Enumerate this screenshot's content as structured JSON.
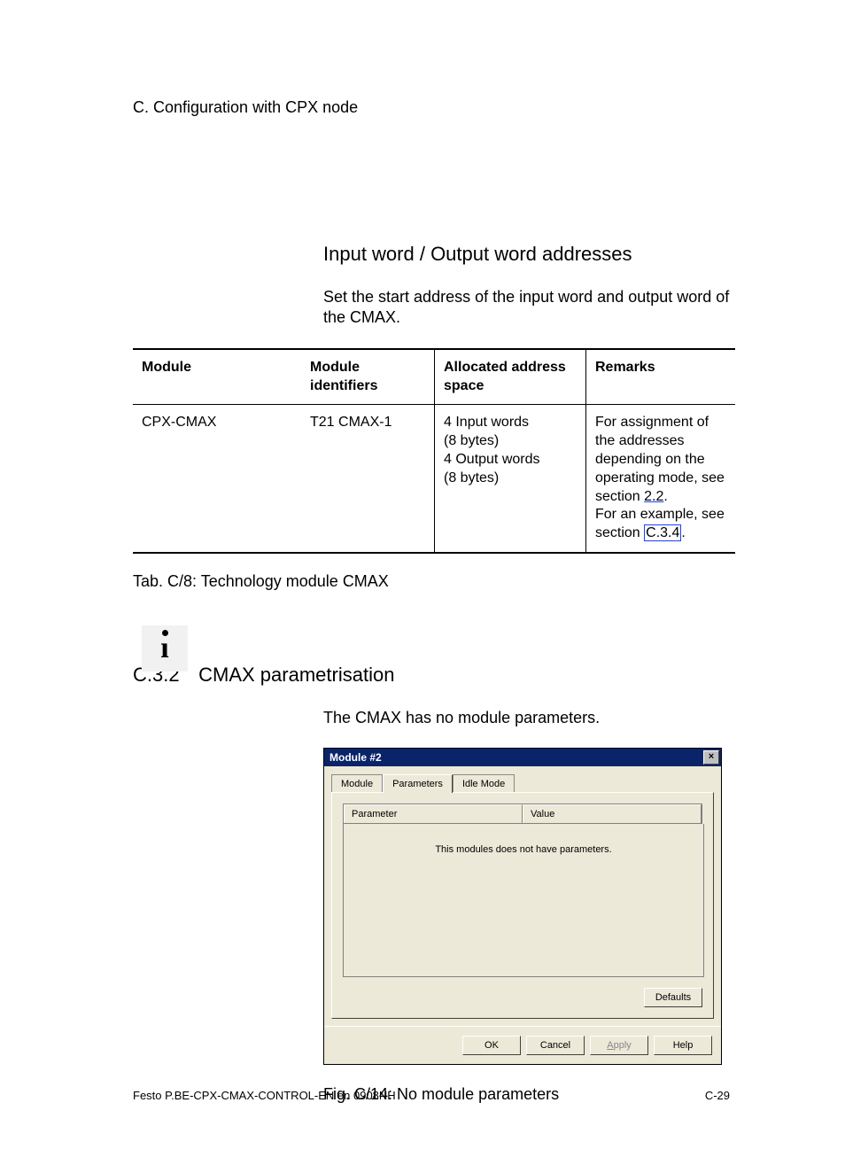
{
  "chapter_label": "C.   Configuration with CPX node",
  "section_io": {
    "title": "Input word / Output word addresses",
    "body": "Set the start address of the input word and output word of the CMAX."
  },
  "table": {
    "headers": {
      "module": "Module",
      "identifiers": "Module identifiers",
      "space": "Allocated address space",
      "remarks": "Remarks"
    },
    "row": {
      "module": "CPX-CMAX",
      "identifiers": "T21 CMAX-1",
      "space": "4 Input words\n(8 bytes)\n4 Output words\n(8 bytes)",
      "remarks_pre": "For assignment of the addresses depending on the operating mode, see section ",
      "remarks_ref1": "2.2",
      "remarks_mid": ".\nFor an example, see section ",
      "remarks_ref2": "C.3.4",
      "remarks_post": "."
    },
    "caption": "Tab. C/8:   Technology module CMAX"
  },
  "section_c32": {
    "number": "C.3.2",
    "title": "CMAX parametrisation",
    "body": "The CMAX has no module parameters."
  },
  "dialog": {
    "title": "Module #2",
    "tabs": [
      "Module",
      "Parameters",
      "Idle Mode"
    ],
    "active_tab": 1,
    "col_parameter": "Parameter",
    "col_value": "Value",
    "empty_msg": "This modules does not have parameters.",
    "btn_defaults": "Defaults",
    "btn_ok": "OK",
    "btn_cancel": "Cancel",
    "btn_apply": "Apply",
    "btn_help": "Help"
  },
  "figure_caption": "Fig. C/14:  No module parameters",
  "footer_left": "Festo P.BE-CPX-CMAX-CONTROL-EN  en 0908NH",
  "footer_right": "C-29"
}
